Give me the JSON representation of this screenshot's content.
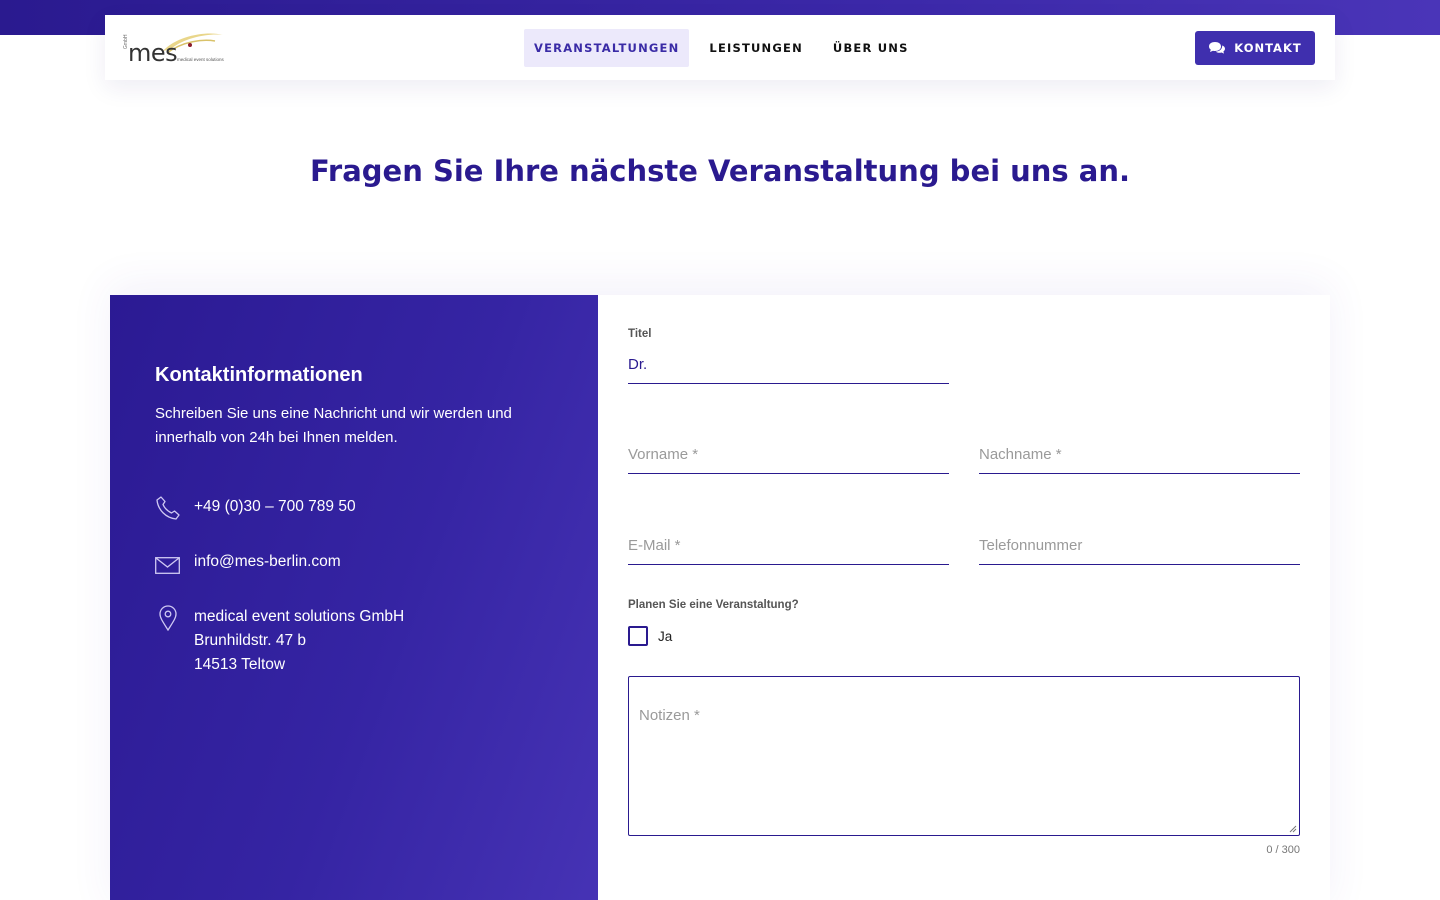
{
  "nav": {
    "logo_text": "mes",
    "logo_sub": "medical event solutions",
    "logo_side": "GmbH",
    "links": [
      {
        "label": "VERANSTALTUNGEN",
        "active": true
      },
      {
        "label": "LEISTUNGEN",
        "active": false
      },
      {
        "label": "ÜBER UNS",
        "active": false
      }
    ],
    "contact_label": "KONTAKT"
  },
  "headline": "Fragen Sie Ihre nächste Veranstaltung bei uns an.",
  "info": {
    "title": "Kontaktinformationen",
    "text": "Schreiben Sie uns eine Nachricht und wir werden und innerhalb von 24h bei Ihnen melden.",
    "phone": "+49 (0)30 – 700 789 50",
    "email": "info@mes-berlin.com",
    "address_line1": "medical event solutions GmbH",
    "address_line2": "Brunhildstr. 47 b",
    "address_line3": "14513 Teltow"
  },
  "form": {
    "title_label": "Titel",
    "title_value": "Dr.",
    "firstname_placeholder": "Vorname *",
    "lastname_placeholder": "Nachname *",
    "email_placeholder": "E-Mail *",
    "phone_placeholder": "Telefonnummer",
    "event_question": "Planen Sie eine Veranstaltung?",
    "event_checkbox_label": "Ja",
    "notes_placeholder": "Notizen *",
    "notes_counter": "0 / 300"
  },
  "colors": {
    "primary": "#2a1a8f",
    "button": "#3f2fae",
    "active_nav_bg": "#ece9fb"
  }
}
